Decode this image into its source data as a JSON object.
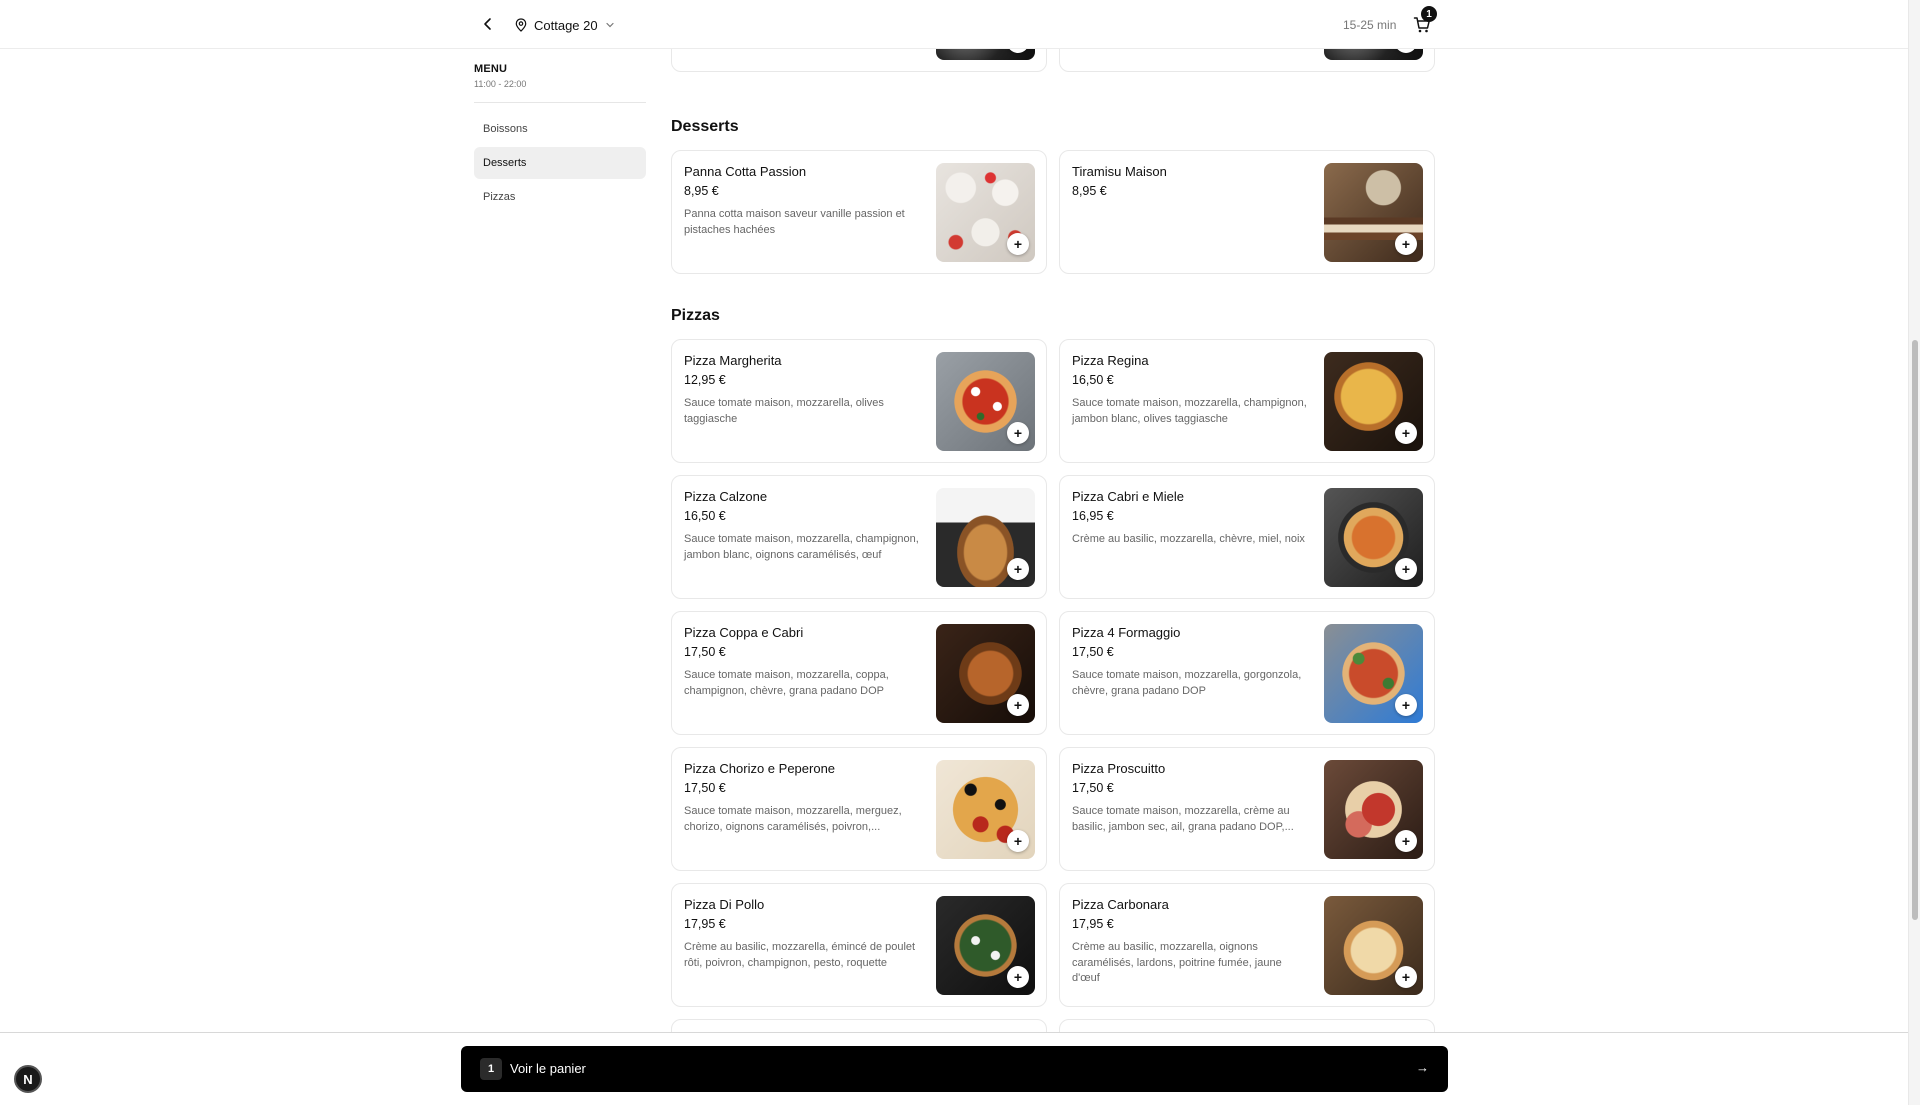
{
  "header": {
    "location": "Cottage 20",
    "eta": "15-25 min",
    "cart_count": "1"
  },
  "sidebar": {
    "title": "MENU",
    "hours": "11:00 - 22:00",
    "items": [
      {
        "label": "Boissons"
      },
      {
        "label": "Desserts"
      },
      {
        "label": "Pizzas"
      }
    ],
    "active_item": "Desserts"
  },
  "sections": {
    "desserts": {
      "title": "Desserts",
      "items": [
        {
          "name": "Panna Cotta Passion",
          "price": "8,95 €",
          "desc": "Panna cotta maison saveur vanille passion et pistaches hachées"
        },
        {
          "name": "Tiramisu Maison",
          "price": "8,95 €",
          "desc": ""
        }
      ]
    },
    "pizzas": {
      "title": "Pizzas",
      "items": [
        {
          "name": "Pizza Margherita",
          "price": "12,95 €",
          "desc": "Sauce tomate maison, mozzarella, olives taggiasche"
        },
        {
          "name": "Pizza Regina",
          "price": "16,50 €",
          "desc": "Sauce tomate maison, mozzarella, champignon, jambon blanc, olives taggiasche"
        },
        {
          "name": "Pizza Calzone",
          "price": "16,50 €",
          "desc": "Sauce tomate maison, mozzarella, champignon, jambon blanc, oignons caramélisés, œuf"
        },
        {
          "name": "Pizza Cabri e Miele",
          "price": "16,95 €",
          "desc": "Crème au basilic, mozzarella, chèvre, miel, noix"
        },
        {
          "name": "Pizza Coppa e Cabri",
          "price": "17,50 €",
          "desc": "Sauce tomate maison, mozzarella, coppa, champignon, chèvre, grana padano DOP"
        },
        {
          "name": "Pizza 4 Formaggio",
          "price": "17,50 €",
          "desc": "Sauce tomate maison, mozzarella, gorgonzola, chèvre, grana padano DOP"
        },
        {
          "name": "Pizza Chorizo e Peperone",
          "price": "17,50 €",
          "desc": "Sauce tomate maison, mozzarella, merguez, chorizo, oignons caramélisés, poivron,..."
        },
        {
          "name": "Pizza Proscuitto",
          "price": "17,50 €",
          "desc": "Sauce tomate maison, mozzarella, crème au basilic, jambon sec, ail, grana padano DOP,..."
        },
        {
          "name": "Pizza Di Pollo",
          "price": "17,95 €",
          "desc": "Crème au basilic, mozzarella, émincé de poulet rôti, poivron, champignon, pesto, roquette"
        },
        {
          "name": "Pizza Carbonara",
          "price": "17,95 €",
          "desc": "Crème au basilic, mozzarella, oignons caramélisés, lardons, poitrine fumée, jaune d'œuf"
        }
      ]
    }
  },
  "add_label": "+",
  "cart_bar": {
    "count": "1",
    "label": "Voir le panier",
    "arrow": "→"
  },
  "next_badge": "N",
  "colors": {
    "accent": "#000000",
    "active_nav_bg": "#efefef",
    "muted_text": "#666666"
  }
}
